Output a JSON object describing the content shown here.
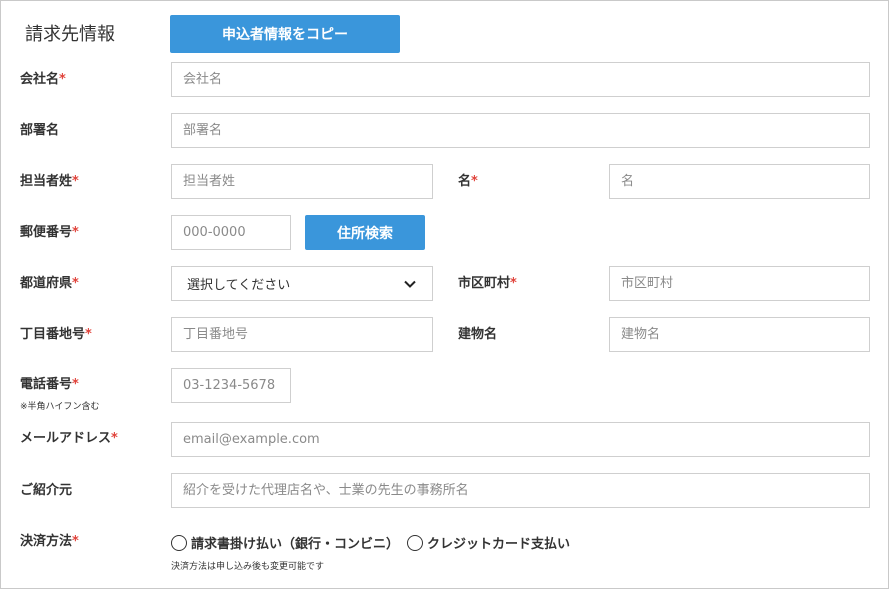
{
  "section": {
    "title": "請求先情報",
    "copy_button": "申込者情報をコピー"
  },
  "required_mark": "*",
  "fields": {
    "company": {
      "label": "会社名",
      "placeholder": "会社名"
    },
    "department": {
      "label": "部署名",
      "placeholder": "部署名"
    },
    "last_name": {
      "label": "担当者姓",
      "placeholder": "担当者姓"
    },
    "first_name": {
      "label": "名",
      "placeholder": "名"
    },
    "postal": {
      "label": "郵便番号",
      "placeholder": "000-0000",
      "search_button": "住所検索"
    },
    "prefecture": {
      "label": "都道府県",
      "selected": "選択してください"
    },
    "city": {
      "label": "市区町村",
      "placeholder": "市区町村"
    },
    "street": {
      "label": "丁目番地号",
      "placeholder": "丁目番地号"
    },
    "building": {
      "label": "建物名",
      "placeholder": "建物名"
    },
    "phone": {
      "label": "電話番号",
      "note": "※半角ハイフン含む",
      "placeholder": "03-1234-5678"
    },
    "email": {
      "label": "メールアドレス",
      "placeholder": "email@example.com"
    },
    "referral": {
      "label": "ご紹介元",
      "placeholder": "紹介を受けた代理店名や、士業の先生の事務所名"
    },
    "payment": {
      "label": "決済方法",
      "options": [
        "請求書掛け払い（銀行・コンビニ）",
        "クレジットカード支払い"
      ],
      "note": "決済方法は申し込み後も変更可能です"
    }
  },
  "colors": {
    "accent": "#3a96db",
    "required": "#e0433b",
    "border": "#cfcfcf"
  }
}
